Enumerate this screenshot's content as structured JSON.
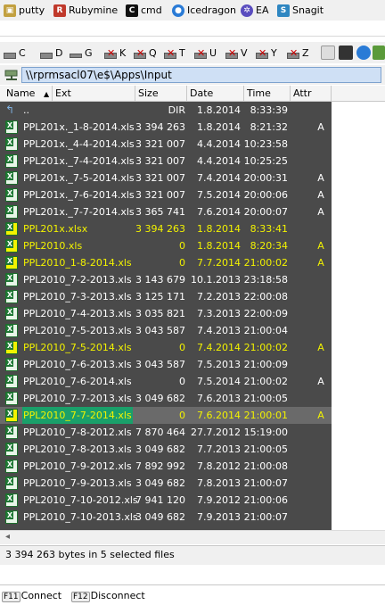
{
  "launchbar": {
    "items": [
      {
        "label": "putty",
        "icon": "putty-icon",
        "color": "#c2a040"
      },
      {
        "label": "Rubymine",
        "icon": "rubymine-icon",
        "color": "#c0392b"
      },
      {
        "label": "cmd",
        "icon": "cmd-icon",
        "color": "#111111"
      },
      {
        "label": "Icedragon",
        "icon": "icedragon-icon",
        "color": "#2a7bd6"
      },
      {
        "label": "EA",
        "icon": "ea-icon",
        "color": "#5a4dbf"
      },
      {
        "label": "Snagit",
        "icon": "snagit-icon",
        "color": "#2e86c1"
      }
    ]
  },
  "drivebar": {
    "drives": [
      "C",
      "D",
      "G",
      "K",
      "Q",
      "T",
      "U",
      "V",
      "Y",
      "Z"
    ]
  },
  "path": {
    "value": "\\\\rprmsacl07\\e$\\Apps\\Input"
  },
  "columns": {
    "name": "Name",
    "ext": "Ext",
    "size": "Size",
    "date": "Date",
    "time": "Time",
    "attr": "Attr"
  },
  "files": [
    {
      "name": "..",
      "ext": "",
      "size": "DIR",
      "date": "1.8.2014",
      "time": "8:33:39",
      "attr": "",
      "marked": false,
      "cursor": false,
      "up": true
    },
    {
      "name": "PPL201x._1-8-2014.xls",
      "size": "3 394 263",
      "date": "1.8.2014",
      "time": "8:21:32",
      "attr": "A",
      "marked": false,
      "cursor": false
    },
    {
      "name": "PPL201x._4-4-2014.xls",
      "size": "3 321 007",
      "date": "4.4.2014",
      "time": "10:23:58",
      "attr": "",
      "marked": false,
      "cursor": false
    },
    {
      "name": "PPL201x._7-4-2014.xls",
      "size": "3 321 007",
      "date": "4.4.2014",
      "time": "10:25:25",
      "attr": "",
      "marked": false,
      "cursor": false
    },
    {
      "name": "PPL201x._7-5-2014.xls",
      "size": "3 321 007",
      "date": "7.4.2014",
      "time": "20:00:31",
      "attr": "A",
      "marked": false,
      "cursor": false
    },
    {
      "name": "PPL201x._7-6-2014.xls",
      "size": "3 321 007",
      "date": "7.5.2014",
      "time": "20:00:06",
      "attr": "A",
      "marked": false,
      "cursor": false
    },
    {
      "name": "PPL201x._7-7-2014.xls",
      "size": "3 365 741",
      "date": "7.6.2014",
      "time": "20:00:07",
      "attr": "A",
      "marked": false,
      "cursor": false
    },
    {
      "name": "PPL201x.xlsx",
      "size": "3 394 263",
      "date": "1.8.2014",
      "time": "8:33:41",
      "attr": "",
      "marked": true,
      "cursor": false
    },
    {
      "name": "PPL2010.xls",
      "size": "0",
      "date": "1.8.2014",
      "time": "8:20:34",
      "attr": "A",
      "marked": true,
      "cursor": false
    },
    {
      "name": "PPL2010_1-8-2014.xls",
      "size": "0",
      "date": "7.7.2014",
      "time": "21:00:02",
      "attr": "A",
      "marked": true,
      "cursor": false
    },
    {
      "name": "PPL2010_7-2-2013.xls",
      "size": "3 143 679",
      "date": "10.1.2013",
      "time": "23:18:58",
      "attr": "",
      "marked": false,
      "cursor": false
    },
    {
      "name": "PPL2010_7-3-2013.xls",
      "size": "3 125 171",
      "date": "7.2.2013",
      "time": "22:00:08",
      "attr": "",
      "marked": false,
      "cursor": false
    },
    {
      "name": "PPL2010_7-4-2013.xls",
      "size": "3 035 821",
      "date": "7.3.2013",
      "time": "22:00:09",
      "attr": "",
      "marked": false,
      "cursor": false
    },
    {
      "name": "PPL2010_7-5-2013.xls",
      "size": "3 043 587",
      "date": "7.4.2013",
      "time": "21:00:04",
      "attr": "",
      "marked": false,
      "cursor": false
    },
    {
      "name": "PPL2010_7-5-2014.xls",
      "size": "0",
      "date": "7.4.2014",
      "time": "21:00:02",
      "attr": "A",
      "marked": true,
      "cursor": false
    },
    {
      "name": "PPL2010_7-6-2013.xls",
      "size": "3 043 587",
      "date": "7.5.2013",
      "time": "21:00:09",
      "attr": "",
      "marked": false,
      "cursor": false
    },
    {
      "name": "PPL2010_7-6-2014.xls",
      "size": "0",
      "date": "7.5.2014",
      "time": "21:00:02",
      "attr": "A",
      "marked": false,
      "cursor": false
    },
    {
      "name": "PPL2010_7-7-2013.xls",
      "size": "3 049 682",
      "date": "7.6.2013",
      "time": "21:00:05",
      "attr": "",
      "marked": false,
      "cursor": false
    },
    {
      "name": "PPL2010_7-7-2014.xls",
      "size": "0",
      "date": "7.6.2014",
      "time": "21:00:01",
      "attr": "A",
      "marked": true,
      "cursor": true
    },
    {
      "name": "PPL2010_7-8-2012.xls",
      "size": "7 870 464",
      "date": "27.7.2012",
      "time": "15:19:00",
      "attr": "",
      "marked": false,
      "cursor": false
    },
    {
      "name": "PPL2010_7-8-2013.xls",
      "size": "3 049 682",
      "date": "7.7.2013",
      "time": "21:00:05",
      "attr": "",
      "marked": false,
      "cursor": false
    },
    {
      "name": "PPL2010_7-9-2012.xls",
      "size": "7 892 992",
      "date": "7.8.2012",
      "time": "21:00:08",
      "attr": "",
      "marked": false,
      "cursor": false
    },
    {
      "name": "PPL2010_7-9-2013.xls",
      "size": "3 049 682",
      "date": "7.8.2013",
      "time": "21:00:07",
      "attr": "",
      "marked": false,
      "cursor": false
    },
    {
      "name": "PPL2010_7-10-2012.xls",
      "size": "7 941 120",
      "date": "7.9.2012",
      "time": "21:00:06",
      "attr": "",
      "marked": false,
      "cursor": false
    },
    {
      "name": "PPL2010_7-10-2013.xls",
      "size": "3 049 682",
      "date": "7.9.2013",
      "time": "21:00:07",
      "attr": "",
      "marked": false,
      "cursor": false
    }
  ],
  "status": {
    "text": "3 394 263 bytes in 5 selected files"
  },
  "fkeys": [
    {
      "key": "F11",
      "label": "Connect"
    },
    {
      "key": "F12",
      "label": "Disconnect"
    }
  ],
  "colors": {
    "list_bg": "#4a4a4a",
    "marked_text": "#f2f200",
    "cursor_bg": "#1aa06a",
    "path_bg": "#cfe0f5"
  }
}
